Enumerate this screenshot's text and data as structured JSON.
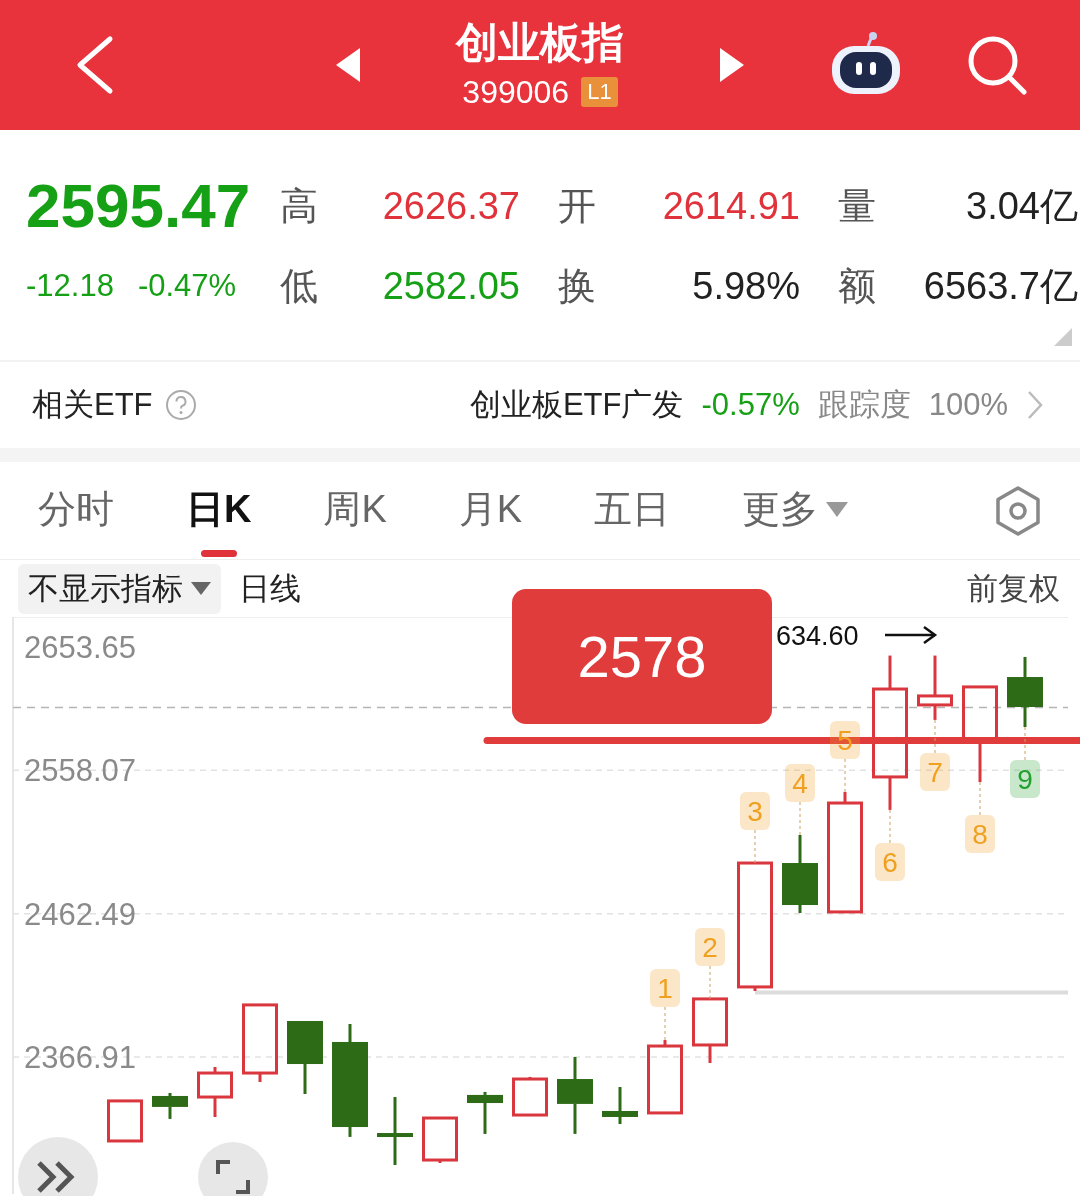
{
  "header": {
    "title": "创业板指",
    "code": "399006",
    "badge": "L1"
  },
  "quote": {
    "price": "2595.47",
    "change": "-12.18",
    "change_pct": "-0.47%",
    "color": "#16a016",
    "stats": [
      {
        "label": "高",
        "value": "2626.37",
        "color": "#e0323a"
      },
      {
        "label": "开",
        "value": "2614.91",
        "color": "#e0323a"
      },
      {
        "label": "量",
        "value": "3.04亿",
        "color": "#222222"
      },
      {
        "label": "低",
        "value": "2582.05",
        "color": "#16a016"
      },
      {
        "label": "换",
        "value": "5.98%",
        "color": "#222222"
      },
      {
        "label": "额",
        "value": "6563.7亿",
        "color": "#222222"
      }
    ]
  },
  "etf": {
    "label": "相关ETF",
    "name": "创业板ETF广发",
    "change": "-0.57%",
    "color": "#16a016",
    "tracking_label": "跟踪度",
    "tracking": "100%"
  },
  "tabs": [
    {
      "label": "分时",
      "kind": "plain",
      "selected": false
    },
    {
      "label": "日K",
      "kind": "plain",
      "selected": true
    },
    {
      "label": "周K",
      "kind": "plain",
      "selected": false
    },
    {
      "label": "月K",
      "kind": "plain",
      "selected": false
    },
    {
      "label": "五日",
      "kind": "plain",
      "selected": false
    },
    {
      "label": "更多",
      "kind": "dropdown",
      "selected": false
    }
  ],
  "indicator": {
    "dropdown": "不显示指标",
    "period": "日线",
    "adjust": "前复权"
  },
  "chart": {
    "axis_labels": [
      "2653.65",
      "2558.07",
      "2462.49",
      "2366.91"
    ],
    "price_tag": "2578",
    "max_label": "634.60",
    "markers": [
      {
        "label": "1",
        "color": "#f0a020"
      },
      {
        "label": "2",
        "color": "#f0a020"
      },
      {
        "label": "3",
        "color": "#f0a020"
      },
      {
        "label": "4",
        "color": "#f0a020"
      },
      {
        "label": "5",
        "color": "#f0a020"
      },
      {
        "label": "6",
        "color": "#f0a020"
      },
      {
        "label": "7",
        "color": "#f0a020"
      },
      {
        "label": "8",
        "color": "#f0a020"
      },
      {
        "label": "9",
        "color": "#22a030"
      }
    ]
  }
}
